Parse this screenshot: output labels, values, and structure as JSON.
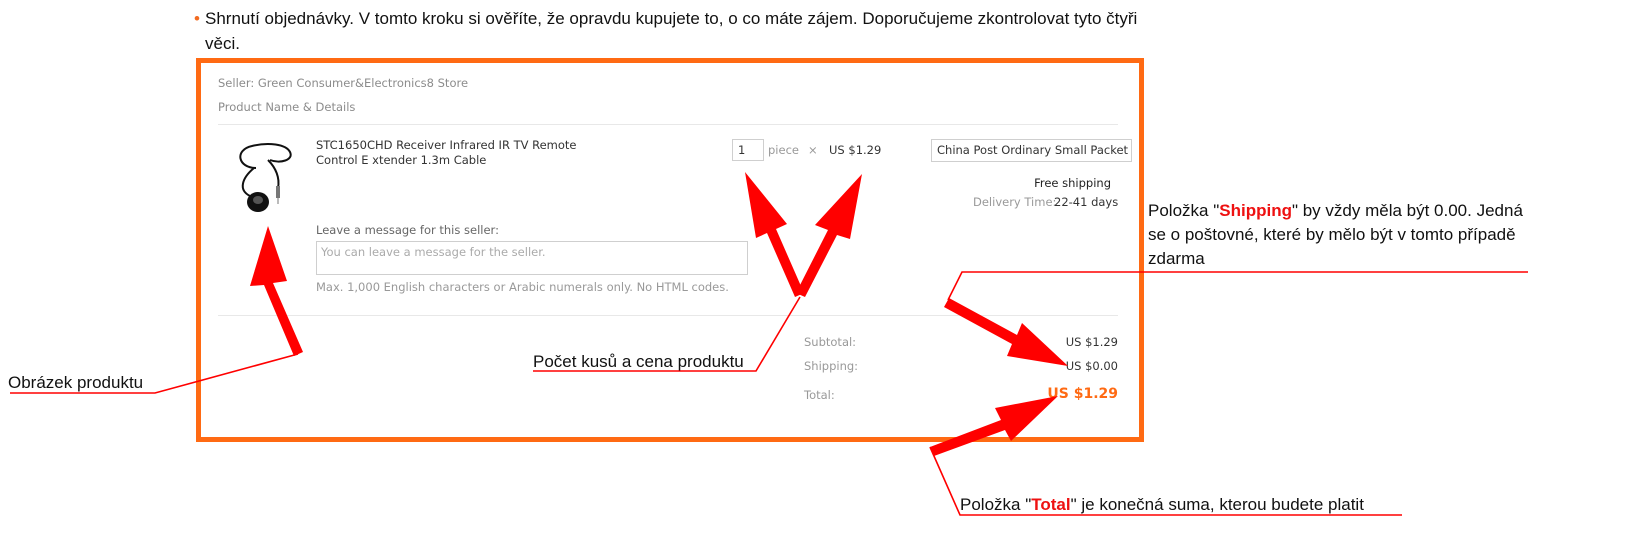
{
  "intro": {
    "bullet": "•",
    "text": "Shrnutí objednávky. V tomto kroku si ověříte, že opravdu kupujete to, o co máte zájem. Doporučujeme zkontrolovat tyto čtyři věci."
  },
  "order": {
    "seller": "Seller: Green Consumer&Electronics8 Store",
    "product_header": "Product Name & Details",
    "product_name": "STC1650CHD Receiver Infrared IR TV Remote Control E xtender 1.3m Cable",
    "quantity_value": "1",
    "quantity_unit": "piece",
    "times": "×",
    "unit_price": "US $1.29",
    "shipping_method": "China Post Ordinary Small Packet Plus",
    "free_shipping": "Free shipping",
    "delivery_label": "Delivery Time:",
    "delivery_value": "22-41 days",
    "message_label": "Leave a message for this seller:",
    "message_placeholder": "You can leave a message for the seller.",
    "message_hint": "Max. 1,000 English characters or Arabic numerals only. No HTML codes.",
    "subtotal_label": "Subtotal:",
    "subtotal_value": "US $1.29",
    "shipping_label": "Shipping:",
    "shipping_value": "US $0.00",
    "total_label": "Total:",
    "total_value": "US $1.29"
  },
  "annotations": {
    "image": "Obrázek produktu",
    "quantity": "Počet kusů a cena produktu",
    "shipping_pre": "Položka \"",
    "shipping_key": "Shipping",
    "shipping_post": "\" by vždy měla být 0.00. Jedná se o poštovné, které by mělo být v tomto případě zdarma",
    "total_pre": "Položka \"",
    "total_key": "Total",
    "total_post": "\" je konečná suma, kterou budete platit"
  },
  "colors": {
    "frame": "#ff6a13",
    "arrow": "#ff0000",
    "total": "#ff6a13",
    "highlight": "#ee1111"
  }
}
